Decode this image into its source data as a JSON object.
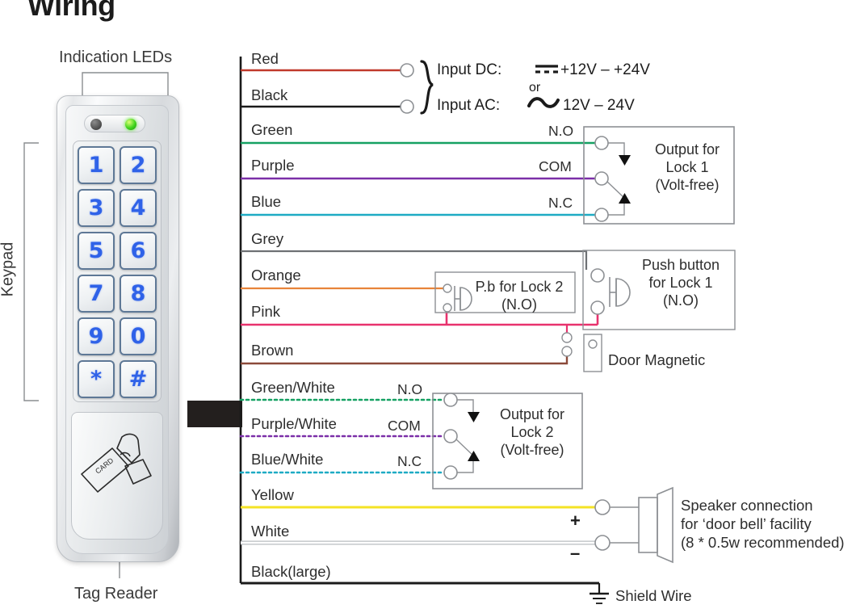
{
  "title": "Wiring",
  "device": {
    "leds_label": "Indication LEDs",
    "keypad_label": "Keypad",
    "tag_reader_label": "Tag Reader",
    "card_glyph_label": "CARD",
    "keys": [
      "1",
      "2",
      "3",
      "4",
      "5",
      "6",
      "7",
      "8",
      "9",
      "0",
      "*",
      "#"
    ]
  },
  "power": {
    "dc_label": "Input DC:",
    "dc_value": "+12V – +24V",
    "or_label": "or",
    "ac_label": "Input AC:",
    "ac_value": "12V –  24V"
  },
  "wires": [
    {
      "name": "Red",
      "color": "#c0392b",
      "style": "solid"
    },
    {
      "name": "Black",
      "color": "#1a1a1a",
      "style": "solid"
    },
    {
      "name": "Green",
      "color": "#16a163",
      "style": "solid"
    },
    {
      "name": "Purple",
      "color": "#7b2fa8",
      "style": "solid"
    },
    {
      "name": "Blue",
      "color": "#1eabc4",
      "style": "solid"
    },
    {
      "name": "Grey",
      "color": "#6e7174",
      "style": "solid"
    },
    {
      "name": "Orange",
      "color": "#e8833a",
      "style": "solid"
    },
    {
      "name": "Pink",
      "color": "#e8326e",
      "style": "solid"
    },
    {
      "name": "Brown",
      "color": "#8b4a3a",
      "style": "solid"
    },
    {
      "name": "Green/White",
      "color": "#16a163",
      "style": "dotted"
    },
    {
      "name": "Purple/White",
      "color": "#7b2fa8",
      "style": "dotted"
    },
    {
      "name": "Blue/White",
      "color": "#1eabc4",
      "style": "dotted"
    },
    {
      "name": "Yellow",
      "color": "#f4e325",
      "style": "solid"
    },
    {
      "name": "White",
      "color": "#ffffff",
      "style": "outline"
    },
    {
      "name": "Black(large)",
      "color": "#1a1a1a",
      "style": "solid"
    }
  ],
  "lock1": {
    "no_label": "N.O",
    "com_label": "COM",
    "nc_label": "N.C",
    "box_line1": "Output for",
    "box_line2": "Lock 1",
    "box_line3": "(Volt-free)"
  },
  "lock2": {
    "no_label": "N.O",
    "com_label": "COM",
    "nc_label": "N.C",
    "box_line1": "Output for",
    "box_line2": "Lock 2",
    "box_line3": "(Volt-free)"
  },
  "pb_lock2": {
    "line1": "P.b for Lock 2",
    "line2": "(N.O)"
  },
  "pb_lock1": {
    "line1": "Push button",
    "line2": "for Lock 1",
    "line3": "(N.O)"
  },
  "door_magnetic": {
    "label": "Door Magnetic"
  },
  "speaker": {
    "plus": "+",
    "minus": "–",
    "line1": "Speaker connection",
    "line2": "for ‘door bell’ facility",
    "line3": "(8 * 0.5w recommended)"
  },
  "shield": {
    "label": "Shield Wire"
  }
}
